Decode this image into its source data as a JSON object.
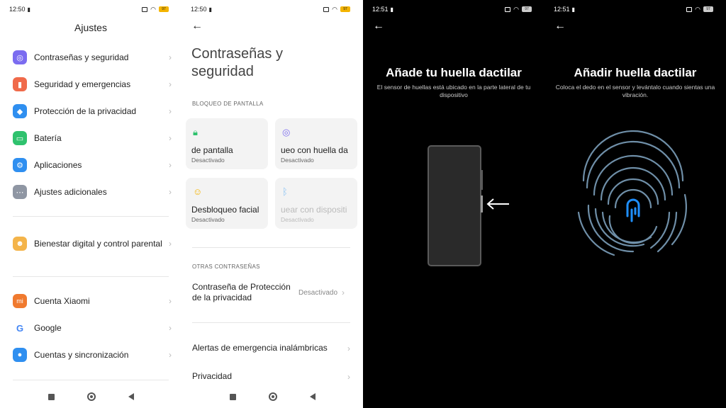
{
  "panel1": {
    "status_time": "12:50",
    "title": "Ajustes",
    "items": [
      {
        "label": "Contraseñas y seguridad",
        "color": "#7b6cf0"
      },
      {
        "label": "Seguridad y emergencias",
        "color": "#f06a4a"
      },
      {
        "label": "Protección de la privacidad",
        "color": "#2f8ff0"
      },
      {
        "label": "Batería",
        "color": "#2fc26e"
      },
      {
        "label": "Aplicaciones",
        "color": "#2f8ff0"
      },
      {
        "label": "Ajustes adicionales",
        "color": "#8f96a3"
      },
      {
        "label": "Bienestar digital y control parental",
        "color": "#f4b44a"
      },
      {
        "label": "Cuenta Xiaomi",
        "color": "#f07a2f"
      },
      {
        "label": "Google",
        "color": "#ffffff"
      },
      {
        "label": "Cuentas y sincronización",
        "color": "#2f8ff0"
      }
    ],
    "xiaomi_icon_text": "mi",
    "google_icon_text": "G"
  },
  "panel2": {
    "status_time": "12:50",
    "title": "Contraseñas y seguridad",
    "section1": "BLOQUEO DE PANTALLA",
    "cards": [
      {
        "title": "de pantalla",
        "status": "Desactivado",
        "icon": "lock-icon",
        "color": "#2fc26e"
      },
      {
        "title": "ueo con huella da",
        "status": "Desactivado",
        "icon": "fingerprint-icon",
        "color": "#7b6cf0"
      },
      {
        "title": "Desbloqueo facial",
        "status": "Desactivado",
        "icon": "face-icon",
        "color": "#f4b400"
      },
      {
        "title": "uear con dispositi",
        "status": "Desactivado",
        "icon": "bluetooth-icon",
        "color": "#8ec5f5"
      }
    ],
    "section2": "OTRAS CONTRASEÑAS",
    "privacy_password": "Contraseña de Protección de la privacidad",
    "privacy_value": "Desactivado",
    "emergency_alerts": "Alertas de emergencia inalámbricas",
    "privacy": "Privacidad"
  },
  "panel3": {
    "status_time": "12:51",
    "title": "Añade tu huella dactilar",
    "subtitle": "El sensor de huellas está ubicado en la parte lateral de tu dispositivo"
  },
  "panel4": {
    "status_time": "12:51",
    "title": "Añadir huella dactilar",
    "subtitle": "Coloca el dedo en el sensor y levántalo cuando sientas una vibración."
  }
}
